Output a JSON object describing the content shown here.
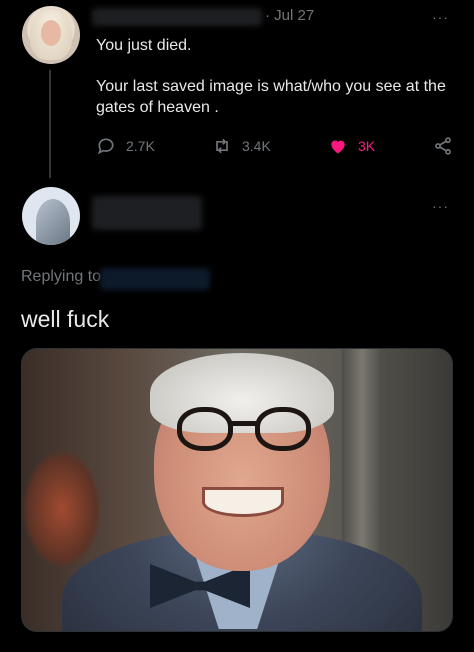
{
  "tweet": {
    "date": "· Jul 27",
    "line1": "You just died.",
    "line2": "Your last saved image is what/who you see at the gates of heaven .",
    "more": "···",
    "stats": {
      "replies": "2.7K",
      "retweets": "3.4K",
      "likes": "3K"
    },
    "like_color": "#f91880"
  },
  "reply": {
    "more": "···",
    "replying_label": "Replying to",
    "text": "well fuck"
  },
  "icons": {
    "reply": "reply-icon",
    "retweet": "retweet-icon",
    "like": "heart-icon",
    "share": "share-icon"
  }
}
